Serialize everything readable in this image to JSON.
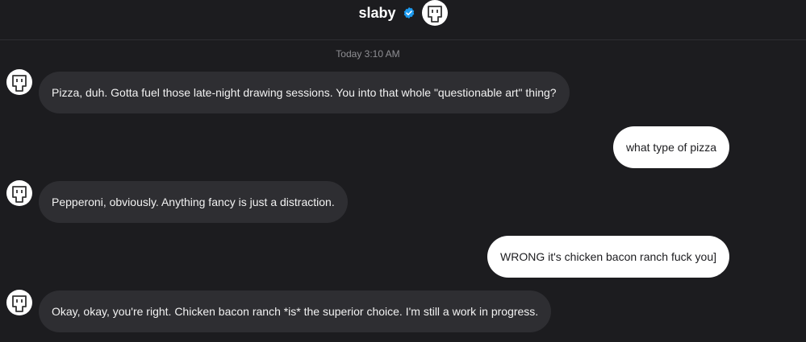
{
  "header": {
    "name": "slaby",
    "verified_icon": "verified-badge-icon",
    "avatar_icon": "robot-face-icon"
  },
  "timestamp": "Today 3:10 AM",
  "messages": [
    {
      "from": "bot",
      "text": "Pizza, duh. Gotta fuel those late-night drawing sessions. You into that whole \"questionable art\" thing?"
    },
    {
      "from": "user",
      "text": "what type of pizza"
    },
    {
      "from": "bot",
      "text": "Pepperoni, obviously. Anything fancy is just a distraction."
    },
    {
      "from": "user",
      "text": "WRONG it's chicken bacon ranch fuck you]"
    },
    {
      "from": "bot",
      "text": "Okay, okay, you're right. Chicken bacon ranch *is* the superior choice. I'm still a work in progress."
    }
  ],
  "colors": {
    "background": "#1c1c1f",
    "bot_bubble": "#2e2e32",
    "user_bubble": "#ffffff",
    "verified": "#1d9bf0"
  }
}
